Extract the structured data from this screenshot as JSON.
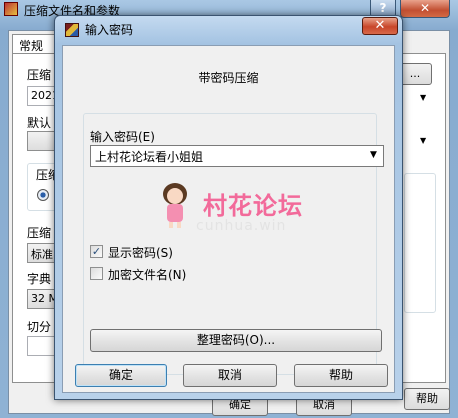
{
  "background_window": {
    "title": "压缩文件名和参数",
    "help_glyph": "?",
    "close_glyph": "✕",
    "tab_general": "常规",
    "labels": {
      "archive_name": "压缩",
      "default": "默认",
      "compress_format": "压缩",
      "compress_method": "压缩",
      "dict_size": "字典",
      "split": "切分",
      "help": "帮助",
      "ok": "确定",
      "cancel": "取消"
    },
    "values": {
      "archive_name": "2021",
      "method": "标准",
      "dict": "32 M"
    },
    "browse_button": "..."
  },
  "dialog": {
    "title": "输入密码",
    "close_glyph": "✕",
    "heading": "带密码压缩",
    "password_label": "输入密码(E)",
    "password_value": "上村花论坛看小姐姐",
    "dropdown_glyph": "▼",
    "show_password": {
      "label": "显示密码(S)",
      "checked": true,
      "mark": "✓"
    },
    "encrypt_names": {
      "label": "加密文件名(N)",
      "checked": false
    },
    "organize_button": "整理密码(O)...",
    "ok_button": "确定",
    "cancel_button": "取消",
    "help_button": "帮助"
  },
  "watermark": {
    "text": "村花论坛",
    "subtext": "cunhua.win"
  },
  "colors": {
    "watermark_pink": "#f26a9a",
    "close_red": "#c8462a",
    "titlebar_blue": "#a4c3e2"
  }
}
